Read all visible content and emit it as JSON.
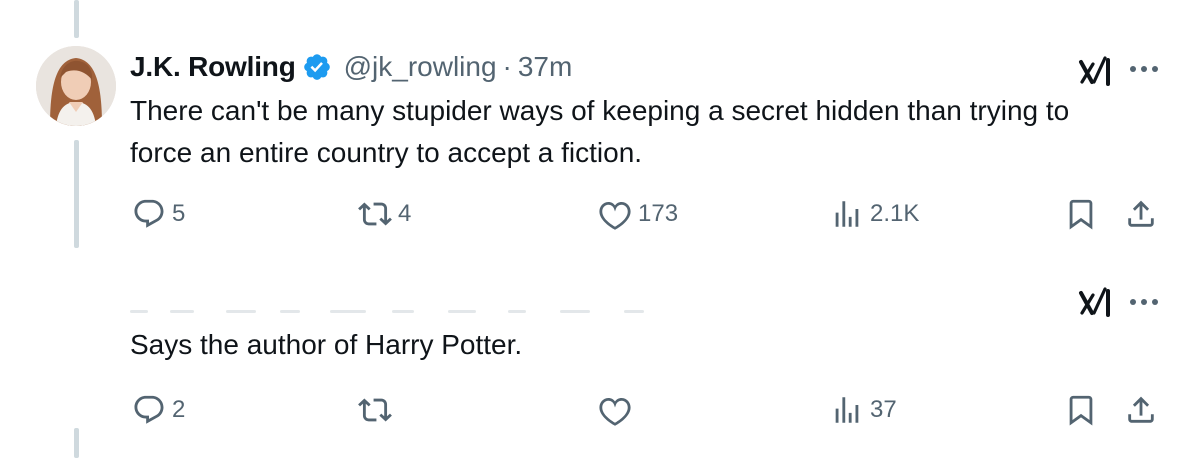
{
  "tweet1": {
    "display_name": "J.K. Rowling",
    "verified": true,
    "handle": "@jk_rowling",
    "separator": "·",
    "time": "37m",
    "text_line1": "There can't be many stupider ways of keeping a secret hidden than trying to",
    "text_line2": "force an entire country to accept a fiction.",
    "replies": "5",
    "reposts": "4",
    "likes": "173",
    "views": "2.1K"
  },
  "tweet2": {
    "text": "Says the author of Harry Potter.",
    "replies": "2",
    "reposts": "",
    "likes": "",
    "views": "37"
  },
  "icons": {
    "reply": "reply-icon",
    "repost": "repost-icon",
    "like": "heart-icon",
    "views": "views-icon",
    "bookmark": "bookmark-icon",
    "share": "share-icon",
    "grok": "grok-icon",
    "more": "more-icon",
    "verified": "verified-badge-icon"
  },
  "colors": {
    "text": "#0f1419",
    "secondary": "#536471",
    "verified_blue": "#1d9bf0",
    "thread_line": "#cfd9de"
  }
}
